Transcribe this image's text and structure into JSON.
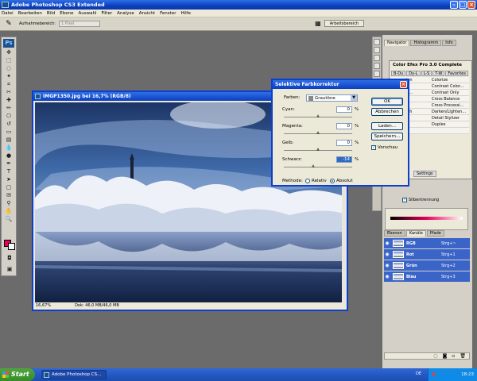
{
  "app": {
    "title": "Adobe Photoshop CS3 Extended"
  },
  "menu": [
    "Datei",
    "Bearbeiten",
    "Bild",
    "Ebene",
    "Auswahl",
    "Filter",
    "Analyse",
    "Ansicht",
    "Fenster",
    "Hilfe"
  ],
  "options": {
    "sample_label": "Aufnahmebereich:",
    "sample_value": "1 Pixel",
    "workspace_label": "Arbeitsbereich"
  },
  "document": {
    "title": "IMGP1350.jpg bei 16,7% (RGB/8)",
    "zoom": "16,67%",
    "doc_info": "Dok: 46,0 MB/46,0 MB"
  },
  "dialog": {
    "title": "Selektive Farbkorrektur",
    "farben_label": "Farben:",
    "farben_value": "Grautöne",
    "sliders": [
      {
        "label": "Cyan:",
        "value": "0",
        "unit": "%",
        "level": 0.5
      },
      {
        "label": "Magenta:",
        "value": "0",
        "unit": "%",
        "level": 0.5
      },
      {
        "label": "Gelb:",
        "value": "0",
        "unit": "%",
        "level": 0.5
      },
      {
        "label": "Schwarz:",
        "value": "-14",
        "unit": "%",
        "level": 0.43
      }
    ],
    "buttons": {
      "ok": "OK",
      "cancel": "Abbrechen",
      "load": "Laden...",
      "save": "Speichern..."
    },
    "preview_label": "Vorschau",
    "preview_checked": true,
    "method_label": "Methode:",
    "method_options": [
      "Relativ",
      "Absolut"
    ],
    "method_selected": "Absolut"
  },
  "panels": {
    "top_tabs": [
      "Navigator",
      "Histogramm",
      "Info"
    ],
    "cefex_title": "Color Efex Pro 3.0 Complete",
    "cefex_tabs": [
      "B-Du",
      "Dy-L",
      "L-S",
      "T-W",
      "Favorites"
    ],
    "cefex_filters": [
      [
        "onversion",
        "Colorize"
      ],
      [
        "Filters",
        "Contrast Color..."
      ],
      [
        "r User D...",
        "Contrast Only"
      ],
      [
        "",
        "Cross Balance"
      ],
      [
        "Bypass",
        "Cross Processi..."
      ],
      [
        "e/Warmth",
        "Darken/Lighten..."
      ],
      [
        "Sienna",
        "Detail Stylizer"
      ],
      [
        "al Soft",
        "Duplex"
      ],
      [
        "tylizer",
        ""
      ]
    ],
    "cefex_settings": "Settings",
    "silbentrennung": "Silbentrennung",
    "layer_tabs": [
      "Ebenen",
      "Kanäle",
      "Pfade"
    ],
    "channels": [
      {
        "name": "RGB",
        "shortcut": "Strg+~"
      },
      {
        "name": "Rot",
        "shortcut": "Strg+1"
      },
      {
        "name": "Grün",
        "shortcut": "Strg+2"
      },
      {
        "name": "Blau",
        "shortcut": "Strg+3"
      }
    ]
  },
  "taskbar": {
    "start": "Start",
    "task": "Adobe Photoshop CS...",
    "lang": "DE",
    "clock": "18:23"
  },
  "colors": {
    "xp_blue": "#0a3fc0",
    "foreground": "#e6005c",
    "background": "#ffffff",
    "channel_highlight": "#3a64c8"
  }
}
